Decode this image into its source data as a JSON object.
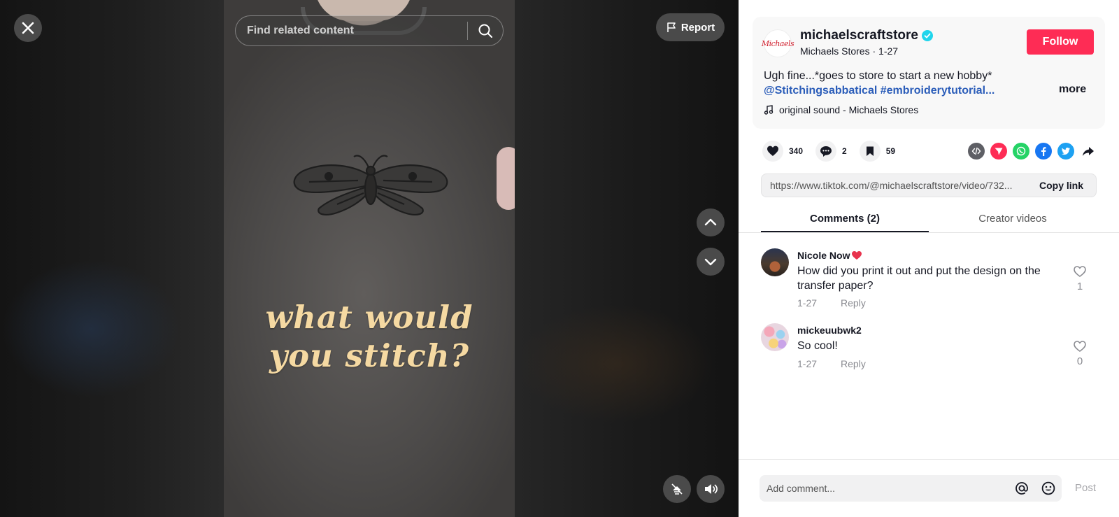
{
  "video": {
    "overlay_line1": "what would",
    "overlay_line2": "you stitch?",
    "search_placeholder": "Find related content",
    "report_label": "Report"
  },
  "creator": {
    "logo_text": "Michaels",
    "username": "michaelscraftstore",
    "verified": true,
    "subline": "Michaels Stores · 1-27",
    "follow_label": "Follow"
  },
  "caption": {
    "text": "Ugh fine...*goes to store to start a new hobby*",
    "mention": "@Stitchingsabbatical",
    "hashtag": "#embroiderytutorial...",
    "more_label": "more"
  },
  "sound": {
    "label": "original sound - Michaels Stores"
  },
  "stats": {
    "likes": "340",
    "comments": "2",
    "saves": "59"
  },
  "share_icons": [
    "embed-icon",
    "send-to-friends-icon",
    "whatsapp-icon",
    "facebook-icon",
    "twitter-icon",
    "share-arrow-icon"
  ],
  "link": {
    "url": "https://www.tiktok.com/@michaelscraftstore/video/732...",
    "copy_label": "Copy link"
  },
  "tabs": [
    {
      "label": "Comments (2)",
      "active": true
    },
    {
      "label": "Creator videos",
      "active": false
    }
  ],
  "comments": [
    {
      "user": "Nicole Now",
      "text": "How did you print it out and put the design on the transfer paper?",
      "date": "1-27",
      "reply_label": "Reply",
      "likes": "1"
    },
    {
      "user": "mickeuubwk2",
      "text": "So cool!",
      "date": "1-27",
      "reply_label": "Reply",
      "likes": "0"
    }
  ],
  "composer": {
    "placeholder": "Add comment...",
    "post_label": "Post"
  },
  "colors": {
    "accent": "#fe2c55",
    "link": "#2b5db9",
    "verified": "#20d5ec"
  }
}
